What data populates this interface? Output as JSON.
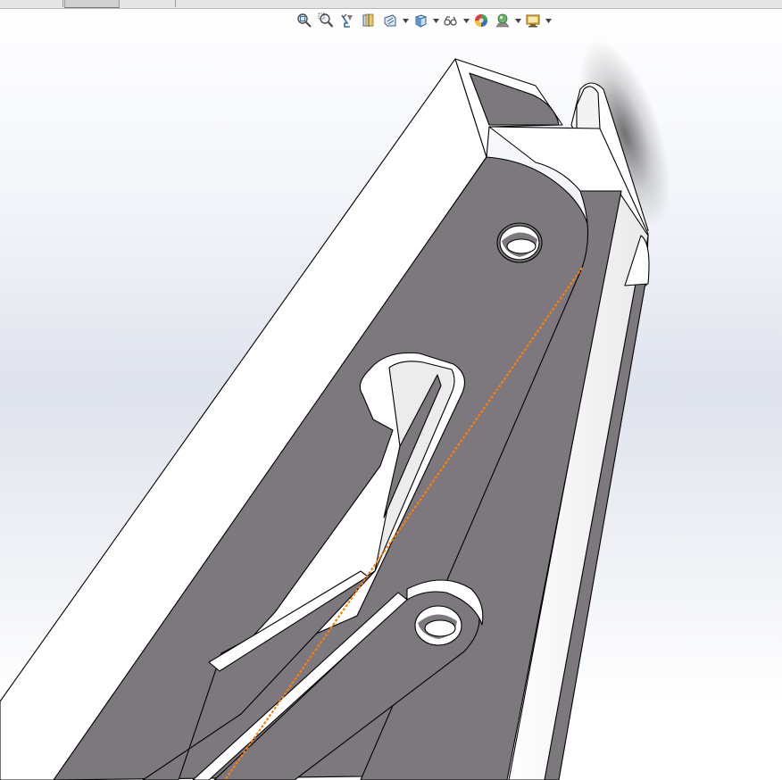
{
  "app": {
    "window": "cad-3d-viewport"
  },
  "heads_up_toolbar": {
    "buttons": [
      {
        "id": "zoom-to-fit",
        "icon": "zoom-to-fit-icon"
      },
      {
        "id": "zoom-to-area",
        "icon": "zoom-to-area-icon"
      },
      {
        "id": "previous-view",
        "icon": "previous-view-icon"
      },
      {
        "id": "section-view",
        "icon": "section-view-icon"
      },
      {
        "id": "dynamic-annotation",
        "icon": "dynamic-annotation-icon",
        "has_dropdown": true
      },
      {
        "id": "view-orientation",
        "icon": "view-orientation-cube-icon",
        "has_dropdown": true
      },
      {
        "id": "display-style",
        "icon": "display-style-icon",
        "has_dropdown": true
      },
      {
        "id": "hide-show-items",
        "icon": "hide-show-items-icon",
        "has_dropdown": true
      },
      {
        "id": "edit-appearance",
        "icon": "edit-appearance-icon"
      },
      {
        "id": "apply-scene",
        "icon": "apply-scene-icon",
        "has_dropdown": true
      },
      {
        "id": "view-settings",
        "icon": "view-settings-icon",
        "has_dropdown": true
      }
    ]
  },
  "colors": {
    "part_dark_face": "#7c787d",
    "part_light_face": "#ffffff",
    "edge": "#000000",
    "selected_edge": "#ff7f00",
    "background_top": "#ffffff",
    "background_mid": "#dfe3ec"
  },
  "model": {
    "description_visible": false
  }
}
